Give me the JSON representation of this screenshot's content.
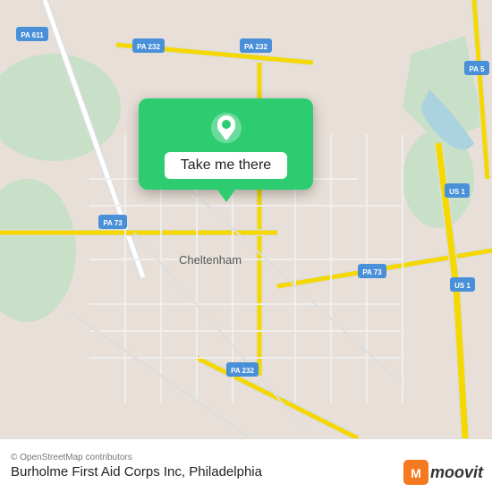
{
  "map": {
    "attribution": "© OpenStreetMap contributors",
    "location_name": "Burholme First Aid Corps Inc, Philadelphia",
    "popup": {
      "button_label": "Take me there"
    }
  },
  "branding": {
    "moovit": "moovit"
  },
  "roads": {
    "labels": [
      "PA 611",
      "PA 232",
      "PA 232",
      "PA 232",
      "PA 73",
      "PA 73",
      "US 1",
      "US 1",
      "PA 5"
    ]
  }
}
